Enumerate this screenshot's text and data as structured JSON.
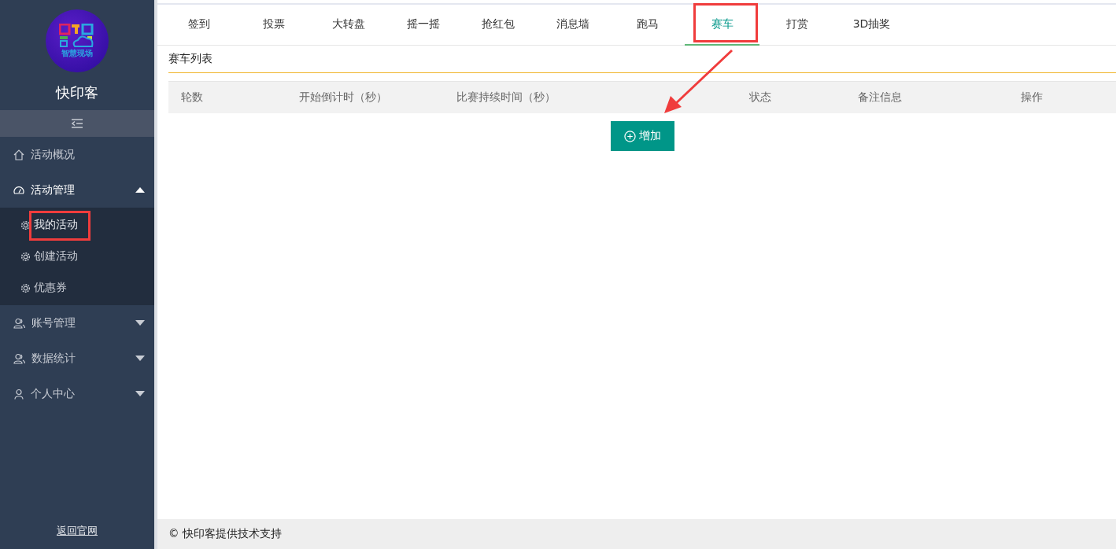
{
  "sidebar": {
    "logo_text": "智慧现场",
    "brand": "快印客",
    "items": [
      {
        "label": "活动概况",
        "kind": "home"
      },
      {
        "label": "活动管理",
        "kind": "gauge",
        "expanded": true,
        "children": [
          {
            "label": "我的活动",
            "selected": true
          },
          {
            "label": "创建活动",
            "selected": false
          },
          {
            "label": "优惠券",
            "selected": false
          }
        ]
      },
      {
        "label": "账号管理",
        "kind": "users",
        "expanded": false
      },
      {
        "label": "数据统计",
        "kind": "users",
        "expanded": false
      },
      {
        "label": "个人中心",
        "kind": "user",
        "expanded": false
      }
    ],
    "footer_link": "返回官网"
  },
  "tabs": [
    {
      "label": "签到",
      "selected": false
    },
    {
      "label": "投票",
      "selected": false
    },
    {
      "label": "大转盘",
      "selected": false
    },
    {
      "label": "摇一摇",
      "selected": false
    },
    {
      "label": "抢红包",
      "selected": false
    },
    {
      "label": "消息墙",
      "selected": false
    },
    {
      "label": "跑马",
      "selected": false
    },
    {
      "label": "赛车",
      "selected": true
    },
    {
      "label": "打赏",
      "selected": false
    },
    {
      "label": "3D抽奖",
      "selected": false
    }
  ],
  "section_title": "赛车列表",
  "table": {
    "columns": [
      "轮数",
      "开始倒计时（秒）",
      "比赛持续时间（秒）",
      "状态",
      "备注信息",
      "操作"
    ]
  },
  "add_button": "增加",
  "footer": "© 快印客提供技术支持"
}
